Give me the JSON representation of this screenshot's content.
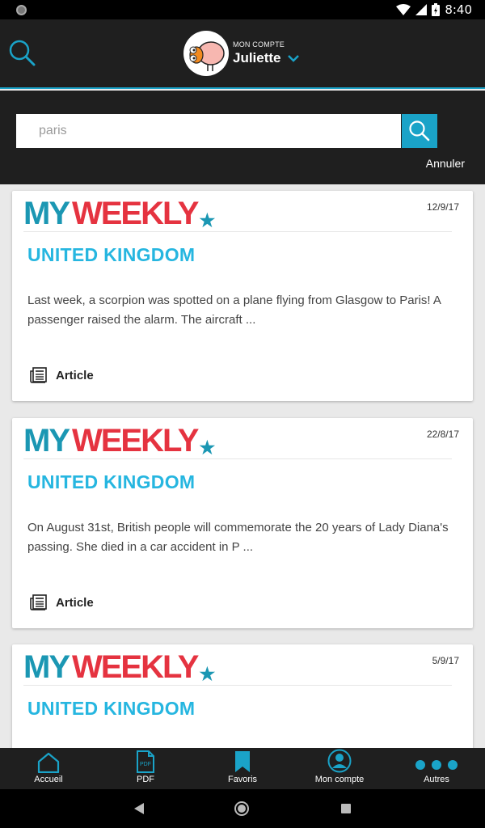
{
  "status": {
    "time": "8:40"
  },
  "header": {
    "account_caption": "MON COMPTE",
    "account_name": "Juliette"
  },
  "search": {
    "query": "paris",
    "cancel_label": "Annuler"
  },
  "results": [
    {
      "brand_my": "MY",
      "brand_weekly": "WEEKLY",
      "brand_star": "★",
      "date": "12/9/17",
      "category": "UNITED KINGDOM",
      "excerpt": "Last week, a scorpion was spotted on a plane flying from Glasgow to Paris! A passenger raised the alarm. The aircraft ...",
      "type": "Article"
    },
    {
      "brand_my": "MY",
      "brand_weekly": "WEEKLY",
      "brand_star": "★",
      "date": "22/8/17",
      "category": "UNITED KINGDOM",
      "excerpt": "On August 31st, British people will commemorate the 20 years of Lady Diana's passing. She died in a car accident in P ...",
      "type": "Article"
    },
    {
      "brand_my": "MY",
      "brand_weekly": "WEEKLY",
      "brand_star": "★",
      "date": "5/9/17",
      "category": "UNITED KINGDOM",
      "excerpt": "",
      "type": ""
    }
  ],
  "bottom_nav": [
    {
      "label": "Accueil",
      "icon": "home-icon"
    },
    {
      "label": "PDF",
      "icon": "pdf-icon",
      "icon_text": "PDF"
    },
    {
      "label": "Favoris",
      "icon": "bookmark-icon"
    },
    {
      "label": "Mon compte",
      "icon": "account-icon"
    },
    {
      "label": "Autres",
      "icon": "more-icon"
    }
  ],
  "colors": {
    "accent": "#1aa3c8",
    "category": "#26b6e0",
    "brand_blue": "#1b97b3",
    "brand_red": "#e53340",
    "bar": "#1f1f1f"
  }
}
